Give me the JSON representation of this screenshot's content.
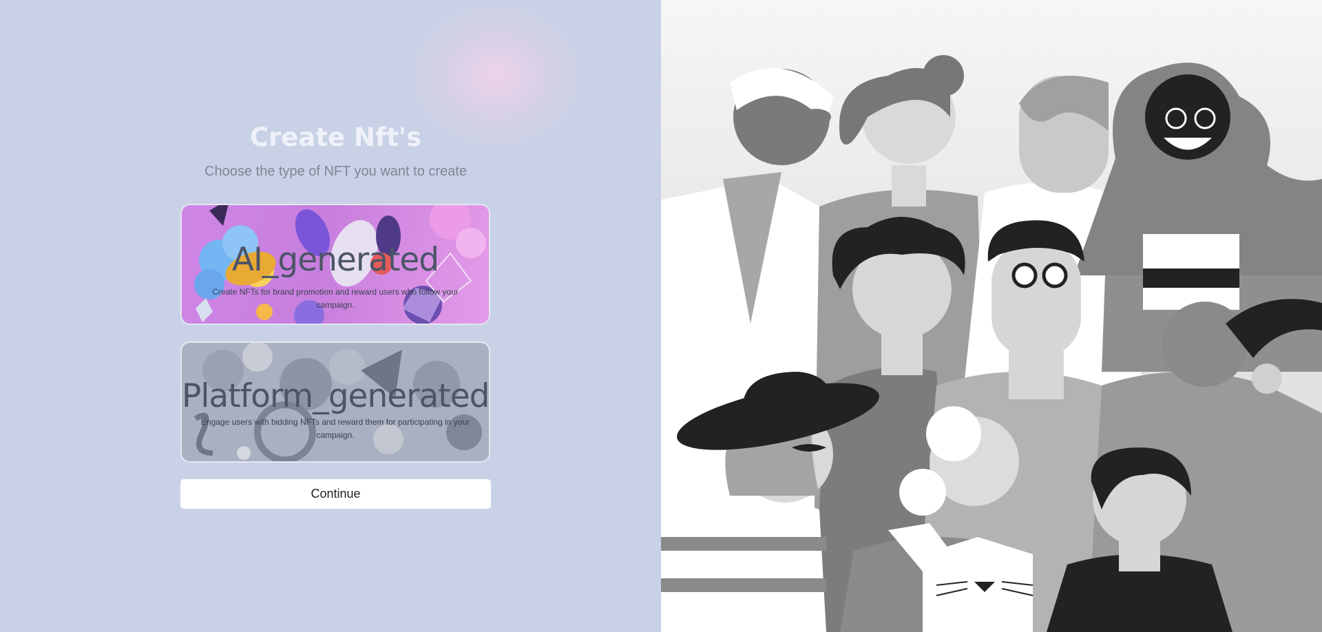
{
  "page": {
    "title": "Create Nft's",
    "subtitle": "Choose the type of NFT you want to create"
  },
  "options": [
    {
      "title": "AI_generated",
      "description": "Create NFTs for brand promotion and reward users who follow your campaign."
    },
    {
      "title": "Platform_generated",
      "description": "Engage users with bidding NFTs and reward them for participating in your campaign."
    }
  ],
  "actions": {
    "continue_label": "Continue"
  },
  "colors": {
    "background": "#c9d1e6",
    "title": "#eef1f8",
    "ai_card": "#cf86e6",
    "platform_card": "#a9b0c1"
  },
  "illustration": {
    "icon": "diverse-crowd-illustration"
  }
}
